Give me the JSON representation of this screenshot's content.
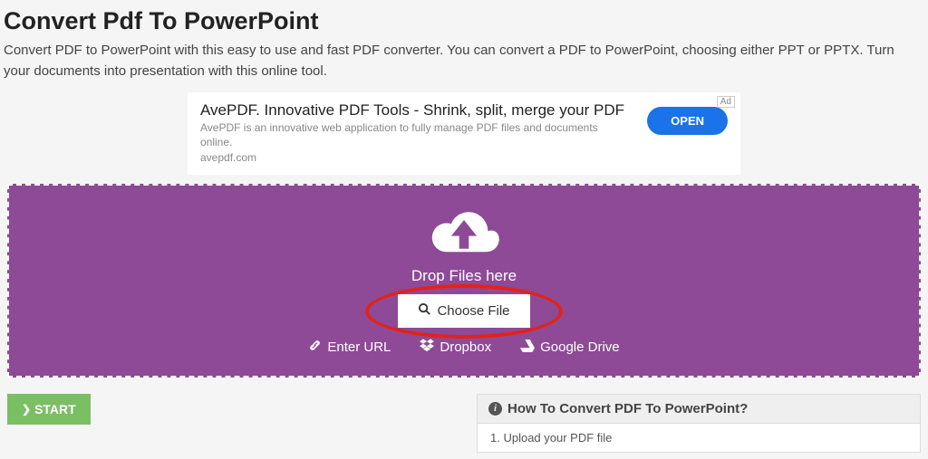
{
  "header": {
    "title": "Convert Pdf To PowerPoint",
    "subtitle": "Convert PDF to PowerPoint with this easy to use and fast PDF converter. You can convert a PDF to PowerPoint, choosing either PPT or PPTX. Turn your documents into presentation with this online tool."
  },
  "ad": {
    "tag": "Ad",
    "title": "AvePDF. Innovative PDF Tools - Shrink, split, merge your PDF",
    "desc": "AvePDF is an innovative web application to fully manage PDF files and documents online.",
    "domain": "avepdf.com",
    "cta": "OPEN"
  },
  "dropzone": {
    "drop_label": "Drop Files here",
    "choose_label": "Choose File",
    "sources": {
      "url": "Enter URL",
      "dropbox": "Dropbox",
      "gdrive": "Google Drive"
    }
  },
  "actions": {
    "start": "START"
  },
  "howto": {
    "title": "How To Convert PDF To PowerPoint?",
    "first_step": "1. Upload your PDF file"
  }
}
